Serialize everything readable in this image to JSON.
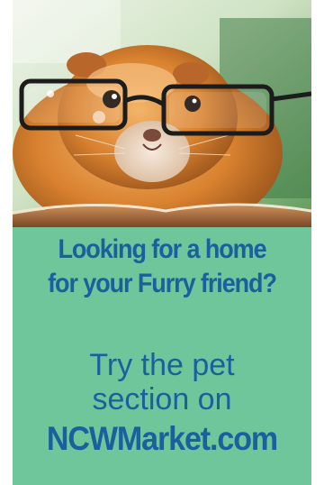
{
  "ad": {
    "headline": {
      "line1": "Looking for a home",
      "line2": "for your Furry friend?"
    },
    "cta": {
      "line1": "Try the pet",
      "line2": "section on"
    },
    "site": "NCWMarket.com"
  },
  "photo": {
    "subject_icon": "guinea-pig-with-glasses-photo"
  },
  "colors": {
    "panel_background": "#6ec69a",
    "text": "#1a5f9e",
    "fur": "#d9822f",
    "glasses": "#1c1c1c"
  }
}
